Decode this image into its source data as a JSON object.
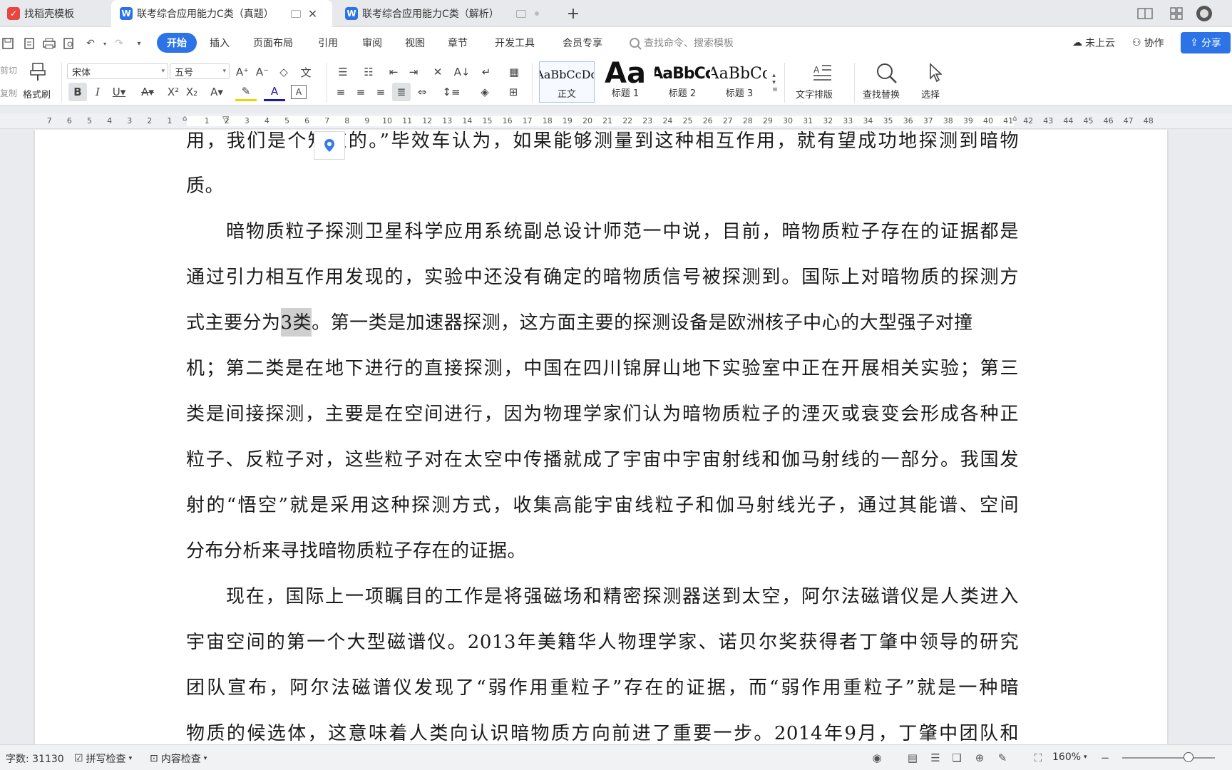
{
  "tabs": [
    {
      "label": "找稻壳模板"
    },
    {
      "label": "联考综合应用能力C类（真题）"
    },
    {
      "label": "联考综合应用能力C类（解析）"
    }
  ],
  "menu": {
    "start": "开始",
    "items": [
      "插入",
      "页面布局",
      "引用",
      "审阅",
      "视图",
      "章节",
      "开发工具",
      "会员专享"
    ],
    "search_placeholder": "查找命令、搜索模板",
    "cloud": "未上云",
    "collab": "协作",
    "share": "分享"
  },
  "ribbon": {
    "cut": "剪切",
    "copy": "复制",
    "format_painter": "格式刷",
    "font_name": "宋体",
    "font_size": "五号",
    "styles": [
      {
        "sample": "AaBbCcDd",
        "name": "正文"
      },
      {
        "sample": "Aa",
        "name": "标题 1"
      },
      {
        "sample": "AaBbCc",
        "name": "标题 2"
      },
      {
        "sample": "AaBbCc",
        "name": "标题 3"
      }
    ],
    "text_layout": "文字排版",
    "find_replace": "查找替换",
    "select": "选择"
  },
  "ruler": {
    "left_numbers": [
      "7",
      "6",
      "5",
      "4",
      "3",
      "2",
      "1"
    ],
    "right_numbers": [
      "1",
      "2",
      "3",
      "4",
      "5",
      "6",
      "7",
      "8",
      "9",
      "10",
      "11",
      "12",
      "13",
      "14",
      "15",
      "16",
      "17",
      "18",
      "19",
      "20",
      "21",
      "22",
      "23",
      "24",
      "25",
      "26",
      "27",
      "28",
      "29",
      "30",
      "31",
      "32",
      "33",
      "34",
      "35",
      "36",
      "37",
      "38",
      "39",
      "40",
      "41",
      "42",
      "43",
      "44",
      "45",
      "46",
      "47",
      "48"
    ]
  },
  "document": {
    "lines": [
      "用，我们是个知道的。”毕效车认为，如果能够测量到这种相互作用，就有望成功地探测到暗物",
      "质。",
      "暗物质粒子探测卫星科学应用系统副总设计师范一中说，目前，暗物质粒子存在的证据都是",
      "通过引力相互作用发现的，实验中还没有确定的暗物质信号被探测到。国际上对暗物质的探测方",
      "式主要分为",
      "3类",
      "。第一类是加速器探测，这方面主要的探测设备是欧洲核子中心的大型强子对撞",
      "机；第二类是在地下进行的直接探测，中国在四川锦屏山地下实验室中正在开展相关实验；第三",
      "类是间接探测，主要是在空间进行，因为物理学家们认为暗物质粒子的湮灭或衰变会形成各种正",
      "粒子、反粒子对，这些粒子对在太空中传播就成了宇宙中宇宙射线和伽马射线的一部分。我国发",
      "射的“悟空”就是采用这种探测方式，收集高能宇宙线粒子和伽马射线光子，通过其能谱、空间",
      "分布分析来寻找暗物质粒子存在的证据。",
      "现在，国际上一项瞩目的工作是将强磁场和精密探测器送到太空，阿尔法磁谱仪是人类进入",
      "宇宙空间的第一个大型磁谱仪。2013年美籍华人物理学家、诺贝尔奖获得者丁肇中领导的研究",
      "团队宣布，阿尔法磁谱仪发现了“弱作用重粒子”存在的证据，而“弱作用重粒子”就是一种暗",
      "物质的候选体，这意味着人类向认识暗物质方向前进了重要一步。2014年9月，丁肇中团队和"
    ]
  },
  "status": {
    "word_count": "字数: 31130",
    "spell_check": "拼写检查",
    "content_check": "内容检查",
    "zoom": "160%"
  }
}
